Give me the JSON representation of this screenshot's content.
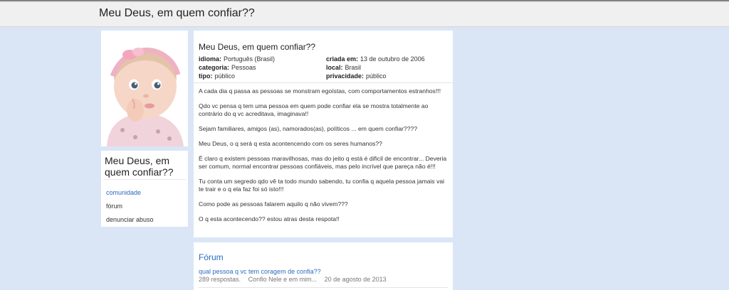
{
  "header": {
    "title": "Meu Deus, em quem confiar??"
  },
  "sidebar": {
    "photo_icon": "baby-photo",
    "name": "Meu Deus, em quem confiar??",
    "nav": [
      {
        "label": "comunidade"
      },
      {
        "label": "fórum"
      },
      {
        "label": "denunciar abuso"
      }
    ]
  },
  "community": {
    "title": "Meu Deus, em quem confiar??",
    "meta": {
      "idioma_label": "idioma:",
      "idioma": "Português (Brasil)",
      "categoria_label": "categoria:",
      "categoria": "Pessoas",
      "tipo_label": "tipo:",
      "tipo": "público",
      "criada_label": "criada em:",
      "criada": "13 de outubro de 2006",
      "local_label": "local:",
      "local": "Brasil",
      "privacidade_label": "privacidade:",
      "privacidade": "público"
    },
    "description": [
      "A cada dia q passa as pessoas se monstram egoístas, com comportamentos estranhos!!!",
      "Qdo vc pensa q tem uma pessoa em quem pode confiar ela se mostra totalmente ao contrário do q vc acreditava, imaginava!!",
      "Sejam familiares, amigos (as), namorados(as), políticos ... em quem confiar????",
      "Meu Deus, o q será q esta acontencendo com os seres humanos??",
      "É claro q existem pessoas maravilhosas, mas do jeito q está é dificil de encontrar... Deveria ser comum, normal encontrar pessoas confiáveis, mas pelo incrível que pareça não é!!!",
      "Tu conta um segredo qdo vê ta todo mundo sabendo, tu confia q aquela pessoa jamais vai te trair e o q ela faz foi só isto!!!",
      "Como pode as pessoas falarem aquilo q não vivem???",
      "O q esta acontecendo?? estou atras desta respota!!"
    ]
  },
  "forum": {
    "title": "Fórum",
    "topics": [
      {
        "title": "qual pessoa q vc tem coragem de confia??",
        "replies": "289 respostas.",
        "last": "Confio Nele e em mim...",
        "date": "20 de agosto de 2013"
      }
    ]
  },
  "colors": {
    "background": "#dae6f5",
    "link": "#2a6ac0"
  }
}
